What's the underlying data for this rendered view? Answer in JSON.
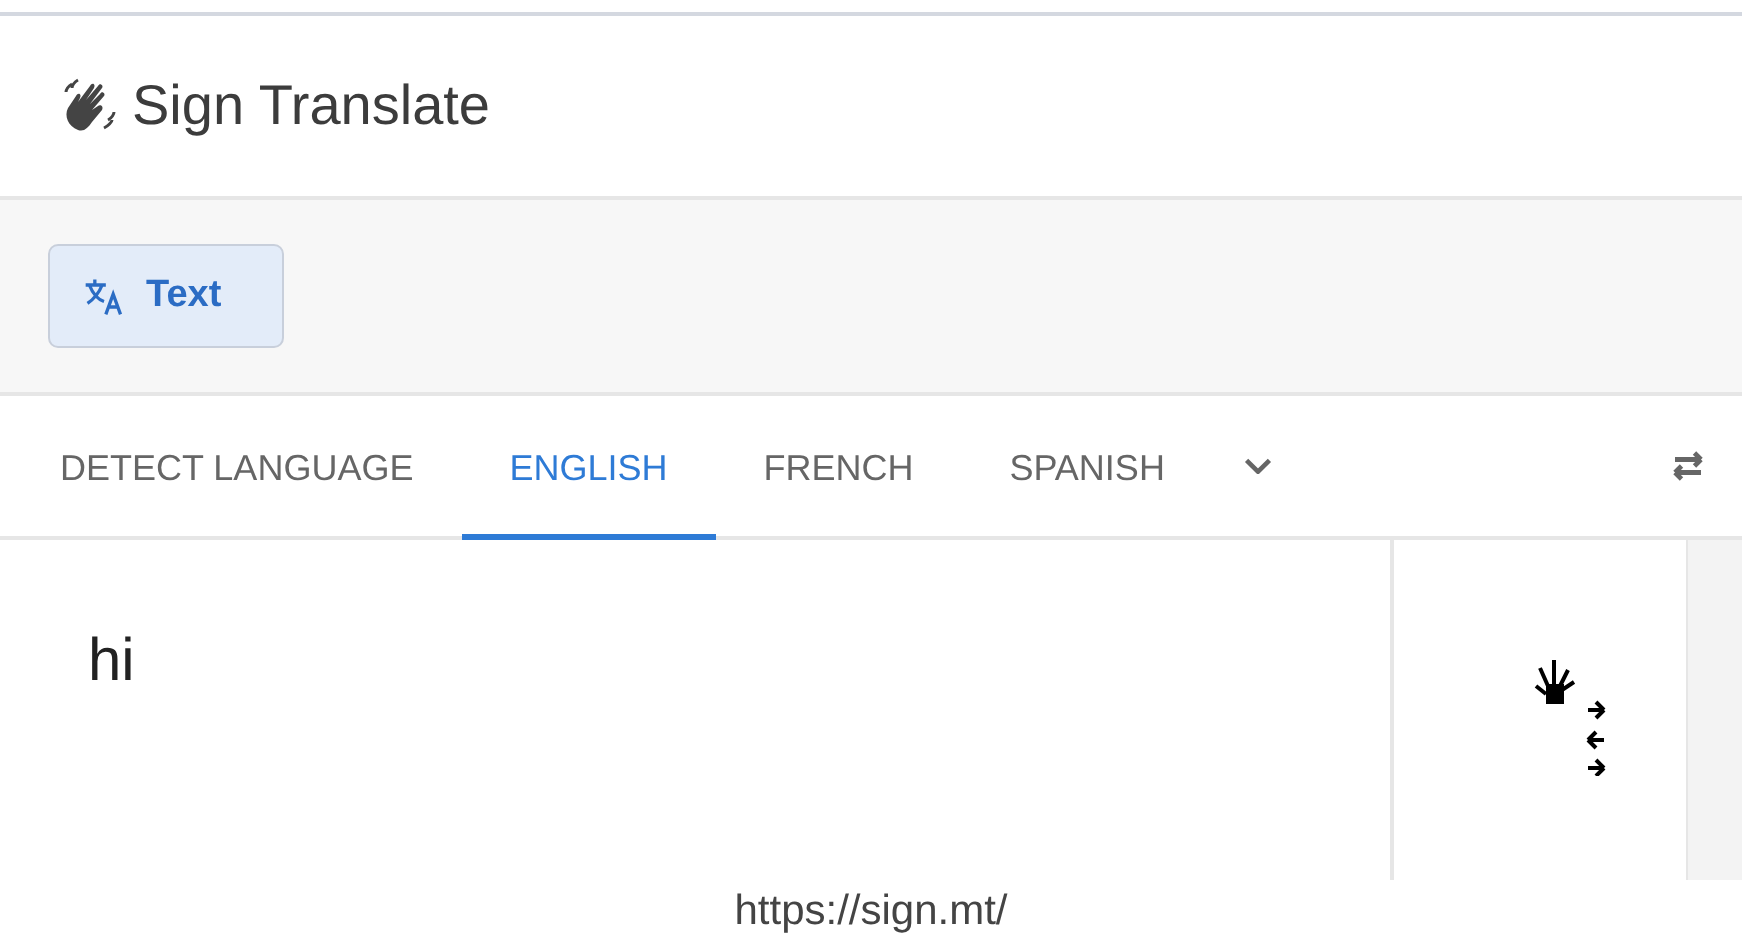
{
  "app": {
    "title": "Sign Translate"
  },
  "modes": [
    {
      "label": "Text",
      "selected": true
    }
  ],
  "languages": [
    {
      "label": "DETECT LANGUAGE",
      "selected": false
    },
    {
      "label": "ENGLISH",
      "selected": true
    },
    {
      "label": "FRENCH",
      "selected": false
    },
    {
      "label": "SPANISH",
      "selected": false
    }
  ],
  "input": {
    "value": "hi"
  },
  "footer": {
    "url": "https://sign.mt/"
  }
}
